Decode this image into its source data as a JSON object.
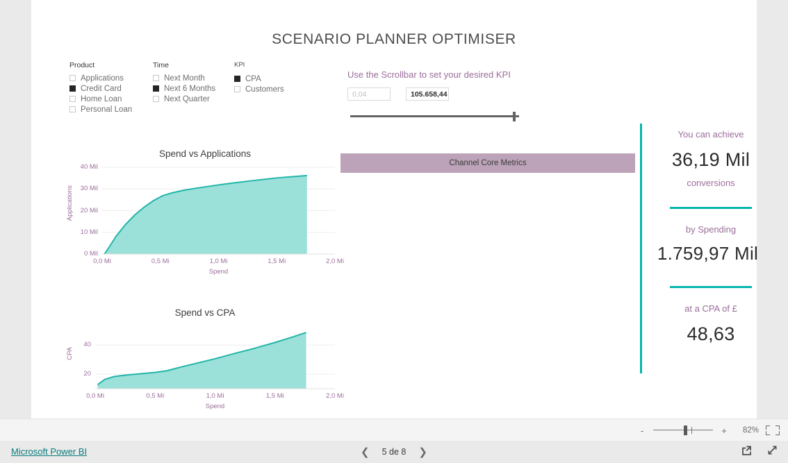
{
  "report": {
    "title": "SCENARIO PLANNER OPTIMISER"
  },
  "slicers": [
    {
      "id": "product",
      "title": "Product",
      "items": [
        {
          "label": "Applications",
          "checked": false
        },
        {
          "label": "Credit Card",
          "checked": true
        },
        {
          "label": "Home Loan",
          "checked": false
        },
        {
          "label": "Personal Loan",
          "checked": false
        }
      ]
    },
    {
      "id": "time",
      "title": "Time",
      "items": [
        {
          "label": "Next Month",
          "checked": false
        },
        {
          "label": "Next 6 Months",
          "checked": true
        },
        {
          "label": "Next Quarter",
          "checked": false
        }
      ]
    },
    {
      "id": "kpi",
      "title": "KPI",
      "items": [
        {
          "label": "CPA",
          "checked": true
        },
        {
          "label": "Customers",
          "checked": false
        }
      ]
    }
  ],
  "kpi_slider": {
    "caption": "Use the Scrollbar to set your desired KPI",
    "min_value": "0,04",
    "max_value": "105.658,44",
    "handle_position_pct": 98
  },
  "channel_bar": {
    "label": "Channel Core Metrics",
    "color": "#bda3b9"
  },
  "kpi_panel": {
    "achieve_label": "You can achieve",
    "conversions_value": "36,19 Mil",
    "conversions_label": "conversions",
    "spending_label": "by Spending",
    "spending_value": "1.759,97 Mil",
    "cpa_label": "at a CPA of £",
    "cpa_value": "48,63",
    "accent_color": "#06b6ab"
  },
  "zoom_bar": {
    "minus": "-",
    "plus": "+",
    "percent": "82%",
    "fit_icon": "fit-to-page-icon"
  },
  "bottom_bar": {
    "brand_link": "Microsoft Power BI",
    "prev_icon": "chevron-left-icon",
    "next_icon": "chevron-right-icon",
    "page_indicator": "5 de 8",
    "share_icon": "share-icon",
    "fullscreen_icon": "fullscreen-icon"
  },
  "chart_data": [
    {
      "type": "area",
      "title": "Spend vs Applications",
      "xlabel": "Spend",
      "ylabel": "Applications",
      "xticks": [
        "0,0 Mi",
        "0,5 Mi",
        "1,0 Mi",
        "1,5 Mi",
        "2,0 Mi"
      ],
      "yticks": [
        "0 Mil",
        "10 Mil",
        "20 Mil",
        "30 Mil",
        "40 Mil"
      ],
      "xlim": [
        0,
        2.0
      ],
      "ylim": [
        0,
        40
      ],
      "grid": true,
      "line_color": "#21b5a8",
      "fill_color": "#9ce0da",
      "x": [
        0.02,
        0.06,
        0.12,
        0.2,
        0.28,
        0.36,
        0.44,
        0.52,
        0.6,
        0.7,
        0.8,
        0.95,
        1.1,
        1.3,
        1.5,
        1.76
      ],
      "y": [
        0.0,
        3.2,
        8.2,
        13.6,
        18.0,
        21.6,
        24.6,
        26.9,
        28.2,
        29.4,
        30.3,
        31.5,
        32.6,
        33.9,
        35.1,
        36.19
      ]
    },
    {
      "type": "area",
      "title": "Spend vs CPA",
      "xlabel": "Spend",
      "ylabel": "CPA",
      "xticks": [
        "0,0 Mi",
        "0,5 Mi",
        "1,0 Mi",
        "1,5 Mi",
        "2,0 Mi"
      ],
      "yticks": [
        "20",
        "40"
      ],
      "xlim": [
        0,
        2.0
      ],
      "ylim": [
        10,
        52
      ],
      "grid": true,
      "line_color": "#21b5a8",
      "fill_color": "#9ce0da",
      "x": [
        0.02,
        0.08,
        0.16,
        0.26,
        0.38,
        0.5,
        0.6,
        0.72,
        0.86,
        1.0,
        1.16,
        1.32,
        1.5,
        1.64,
        1.76
      ],
      "y": [
        12.8,
        16.4,
        18.4,
        19.4,
        20.3,
        21.2,
        22.4,
        25.0,
        27.8,
        30.6,
        34.2,
        37.6,
        41.8,
        45.4,
        48.63
      ]
    }
  ]
}
